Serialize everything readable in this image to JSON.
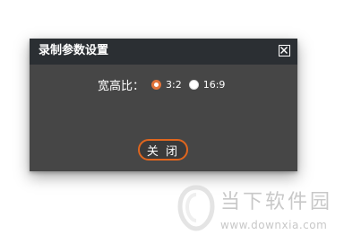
{
  "dialog": {
    "title": "录制参数设置",
    "ratio": {
      "label": "宽高比：",
      "options": [
        {
          "label": "3:2",
          "checked": true
        },
        {
          "label": "16:9",
          "checked": false
        }
      ]
    },
    "close_button_label": "关 闭",
    "colors": {
      "accent": "#e0661e",
      "body_bg": "#464646",
      "titlebar_bg": "#2b2f33"
    }
  },
  "watermark": {
    "site_name": "当下软件园",
    "url": "www.downxia.com"
  }
}
